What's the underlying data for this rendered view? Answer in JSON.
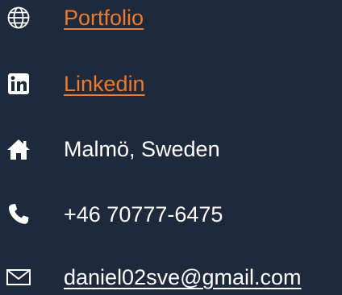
{
  "contact": {
    "portfolio": {
      "icon": "globe-icon",
      "label": "Portfolio"
    },
    "linkedin": {
      "icon": "linkedin-icon",
      "label": "Linkedin"
    },
    "location": {
      "icon": "home-icon",
      "label": "Malmö, Sweden"
    },
    "phone": {
      "icon": "phone-icon",
      "label": "+46 70777-6475"
    },
    "email": {
      "icon": "envelope-icon",
      "label": "daniel02sve@gmail.com"
    }
  },
  "colors": {
    "background": "#1e293b",
    "link": "#ee7a2e",
    "text": "#ffffff"
  }
}
